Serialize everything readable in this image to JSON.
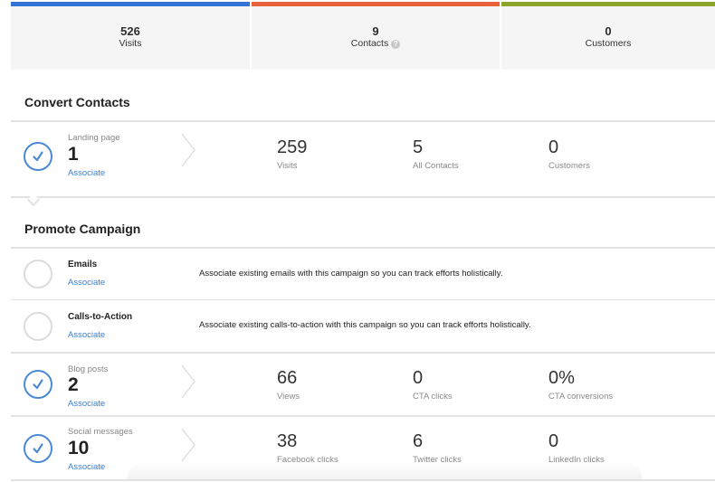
{
  "summary": {
    "tiles": [
      {
        "value": "526",
        "label": "Visits",
        "color": "#3574d4"
      },
      {
        "value": "9",
        "label": "Contacts",
        "color": "#e8613a",
        "help_icon": "?"
      },
      {
        "value": "0",
        "label": "Customers",
        "color": "#8ba52b"
      }
    ]
  },
  "convert": {
    "title": "Convert Contacts",
    "rows": [
      {
        "kind": "Landing page",
        "count": "1",
        "checked": true,
        "associate": "Associate",
        "metrics": [
          {
            "value": "259",
            "label": "Visits"
          },
          {
            "value": "5",
            "label": "All Contacts"
          },
          {
            "value": "0",
            "label": "Customers"
          }
        ]
      }
    ]
  },
  "promote": {
    "title": "Promote Campaign",
    "rows": [
      {
        "kind": "Emails",
        "checked": false,
        "associate": "Associate",
        "description": "Associate existing emails with this campaign so you can track efforts holistically."
      },
      {
        "kind": "Calls-to-Action",
        "checked": false,
        "associate": "Associate",
        "description": "Associate existing calls-to-action with this campaign so you can track efforts holistically."
      },
      {
        "kind": "Blog posts",
        "count": "2",
        "checked": true,
        "associate": "Associate",
        "metrics": [
          {
            "value": "66",
            "label": "Views"
          },
          {
            "value": "0",
            "label": "CTA clicks"
          },
          {
            "value": "0%",
            "label": "CTA conversions"
          }
        ]
      },
      {
        "kind": "Social messages",
        "count": "10",
        "checked": true,
        "associate": "Associate",
        "metrics": [
          {
            "value": "38",
            "label": "Facebook clicks"
          },
          {
            "value": "6",
            "label": "Twitter clicks"
          },
          {
            "value": "0",
            "label": "LinkedIn clicks"
          }
        ]
      }
    ]
  },
  "colors": {
    "accent_link": "#3b80d6",
    "check_blue": "#4a8ad4"
  }
}
